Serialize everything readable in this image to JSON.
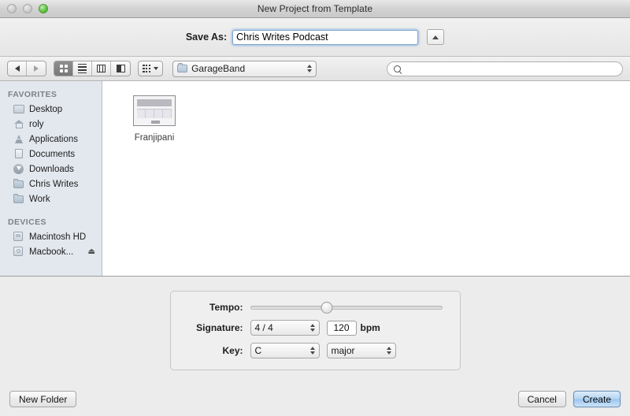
{
  "window": {
    "title": "New Project from Template",
    "traffic_lights": [
      {
        "name": "close",
        "state": "disabled"
      },
      {
        "name": "minimize",
        "state": "disabled"
      },
      {
        "name": "zoom",
        "state": "active",
        "color": "#62c544"
      }
    ]
  },
  "saveas": {
    "label": "Save As:",
    "value": "Chris Writes Podcast",
    "placeholder": "",
    "disclosure_icon": "triangle-up-icon"
  },
  "toolbar": {
    "back_icon": "arrow-left-icon",
    "forward_icon": "arrow-right-icon",
    "view_modes": [
      {
        "name": "icon-view",
        "icon": "grid-icon",
        "selected": true
      },
      {
        "name": "list-view",
        "icon": "list-icon",
        "selected": false
      },
      {
        "name": "column-view",
        "icon": "columns-icon",
        "selected": false
      },
      {
        "name": "coverflow-view",
        "icon": "coverflow-icon",
        "selected": false
      }
    ],
    "arrange": {
      "icon": "arrange-grid-icon",
      "caret": "chevron-down-icon"
    },
    "path_popup": {
      "folder_icon": "folder-icon",
      "label": "GarageBand"
    },
    "search": {
      "icon": "search-icon",
      "value": "",
      "placeholder": ""
    }
  },
  "sidebar": {
    "sections": [
      {
        "header": "FAVORITES",
        "items": [
          {
            "label": "Desktop",
            "icon": "desktop-icon"
          },
          {
            "label": "roly",
            "icon": "home-icon"
          },
          {
            "label": "Applications",
            "icon": "applications-icon"
          },
          {
            "label": "Documents",
            "icon": "document-icon"
          },
          {
            "label": "Downloads",
            "icon": "downloads-icon"
          },
          {
            "label": "Chris Writes",
            "icon": "folder-icon"
          },
          {
            "label": "Work",
            "icon": "folder-icon"
          }
        ]
      },
      {
        "header": "DEVICES",
        "items": [
          {
            "label": "Macintosh HD",
            "icon": "hard-drive-icon",
            "eject": ""
          },
          {
            "label": "Macbook...",
            "icon": "external-drive-icon",
            "eject": "⏏"
          }
        ]
      }
    ]
  },
  "files": [
    {
      "name": "Franjipani",
      "icon": "project-thumbnail-icon"
    }
  ],
  "settings": {
    "tempo": {
      "label": "Tempo:",
      "percent": 40
    },
    "signature": {
      "label": "Signature:",
      "value": "4 / 4"
    },
    "bpm": {
      "value": "120",
      "unit": "bpm"
    },
    "key": {
      "label": "Key:",
      "value": "C",
      "mode": "major"
    }
  },
  "footer": {
    "new_folder": "New Folder",
    "cancel": "Cancel",
    "create": "Create"
  }
}
